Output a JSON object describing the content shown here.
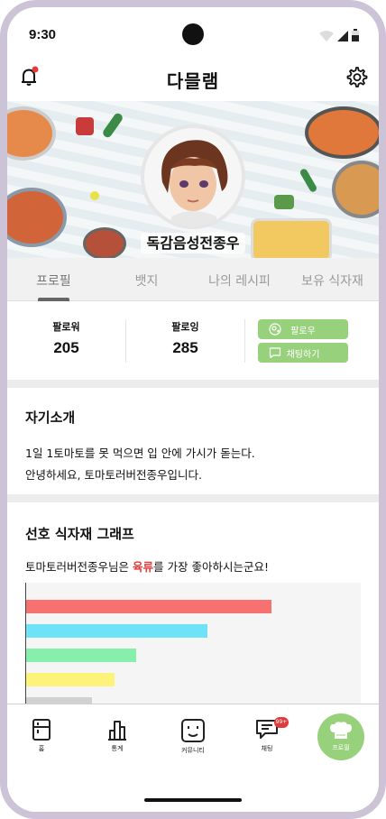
{
  "status": {
    "time": "9:30"
  },
  "header": {
    "app_title": "다믈램"
  },
  "profile": {
    "nickname": "독감음성전종우"
  },
  "tabs": [
    {
      "label": "프로필",
      "active": true
    },
    {
      "label": "뱃지",
      "active": false
    },
    {
      "label": "나의 레시피",
      "active": false
    },
    {
      "label": "보유 식자재",
      "active": false
    }
  ],
  "stats": {
    "followers_label": "팔로워",
    "followers_value": "205",
    "following_label": "팔로잉",
    "following_value": "285"
  },
  "actions": {
    "follow_label": "팔로우",
    "chat_label": "채팅하기"
  },
  "intro": {
    "title": "자기소개",
    "lines": [
      "1일 1토마토를 못 먹으면 입 안에 가시가 돋는다.",
      "안녕하세요, 토마토러버전종우입니다."
    ]
  },
  "graph": {
    "title": "선호 식자재 그래프",
    "desc_prefix": "토마토러버전종우님은 ",
    "desc_highlight": "육류",
    "desc_suffix": "를 가장 좋아하시는군요!"
  },
  "chart_data": {
    "type": "bar",
    "orientation": "horizontal",
    "categories": [
      "",
      "",
      "",
      "",
      ""
    ],
    "values": [
      100,
      74,
      45,
      36,
      27
    ],
    "colors": [
      "#f87171",
      "#6ee3f7",
      "#86efac",
      "#fdf37a",
      "#d1d1d1"
    ],
    "xlim": [
      0,
      137
    ]
  },
  "colors": {
    "accent": "#98d17c",
    "highlight": "#e23b3b"
  },
  "nav": {
    "items": [
      {
        "label": "홈",
        "icon": "fridge-icon"
      },
      {
        "label": "통계",
        "icon": "bar-chart-icon"
      },
      {
        "label": "커뮤니티",
        "icon": "smile-face-icon"
      },
      {
        "label": "채팅",
        "icon": "chat-bubble-icon"
      },
      {
        "label": "프로필",
        "icon": "chef-hat-icon"
      }
    ],
    "chat_badge": "99+"
  }
}
